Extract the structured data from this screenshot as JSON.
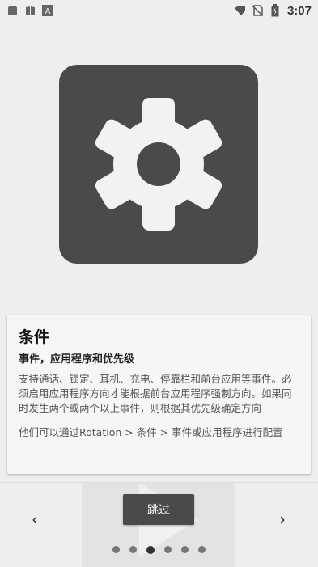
{
  "status_bar": {
    "time": "3:07",
    "icons": [
      "app-square-icon",
      "book-icon",
      "font-a-icon",
      "wifi-icon",
      "no-sim-icon",
      "battery-charging-icon"
    ]
  },
  "hero": {
    "icon": "settings-gear-icon",
    "bg_color": "#4a4a4a"
  },
  "card": {
    "title": "条件",
    "subtitle": "事件，应用程序和优先级",
    "body": "支持通话、锁定、耳机、充电、停靠栏和前台应用等事件。必须启用应用程序方向才能根据前台应用程序强制方向。如果同时发生两个或两个以上事件，则根据其优先级确定方向",
    "footer": "他们可以通过Rotation > 条件 > 事件或应用程序进行配置"
  },
  "bottom_nav": {
    "prev_label": "‹",
    "next_label": "›",
    "skip_label": "跳过",
    "page_count": 6,
    "active_page": 3
  }
}
